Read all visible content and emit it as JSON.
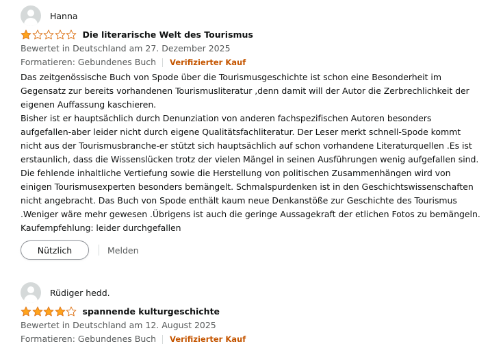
{
  "colors": {
    "star_fill": "#ffa41c",
    "star_empty_stroke": "#de7921",
    "verified": "#c45500",
    "meta": "#565959"
  },
  "reviews": [
    {
      "author": "Hanna",
      "rating": 1,
      "title": "Die literarische Welt des Tourismus",
      "meta": "Bewertet in Deutschland am 27. Dezember 2025",
      "format": "Formatieren: Gebundenes Buch",
      "verified": "Verifizierter Kauf",
      "body_lines": [
        "Das zeitgenössische Buch von Spode über die Tourismusgeschichte ist schon eine Besonderheit im",
        "Gegensatz zur bereits vorhandenen Tourismusliteratur ,denn damit will der Autor die Zerbrechlichkeit der",
        "eigenen Auffassung kaschieren.",
        "Bisher ist er hauptsächlich durch Denunziation von anderen fachspezifischen Autoren besonders",
        "aufgefallen-aber leider nicht durch eigene Qualitätsfachliteratur. Der Leser merkt schnell-Spode kommt",
        "nicht aus der Tourismusbranche-er stützt sich hauptsächlich auf schon vorhandene Literaturquellen .Es ist",
        "erstaunlich, dass die Wissenslücken trotz der vielen Mängel in seinen Ausführungen wenig aufgefallen sind.",
        "Die fehlende inhaltliche Vertiefung sowie die Herstellung von politischen Zusammenhängen wird von",
        "einigen Tourismusexperten besonders bemängelt. Schmalspurdenken ist in den Geschichtswissenschaften",
        "nicht angebracht. Das Buch von Spode enthält kaum neue Denkanstöße zur Geschichte des Tourismus",
        ".Weniger wäre mehr gewesen .Übrigens ist auch die geringe Aussagekraft der etlichen Fotos zu bemängeln.",
        "Kaufempfehlung: leider durchgefallen"
      ],
      "helpful_label": "Nützlich",
      "report_label": "Melden"
    },
    {
      "author": "Rüdiger hedd.",
      "rating": 4,
      "title": "spannende kulturgeschichte",
      "meta": "Bewertet in Deutschland am 12. August 2025",
      "format": "Formatieren: Gebundenes Buch",
      "verified": "Verifizierter Kauf"
    }
  ]
}
